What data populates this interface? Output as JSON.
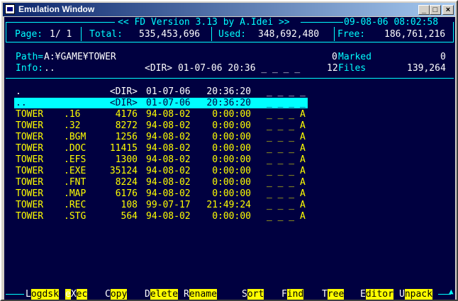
{
  "window": {
    "title": "Emulation Window",
    "min": "_",
    "max": "□",
    "close": "×"
  },
  "header": {
    "version": "<< FD Version 3.13 by A.Idei >>",
    "datetime": "09-08-06 08:02:58",
    "page_label": "Page:",
    "page_value": "1/ 1",
    "total_label": "Total:",
    "total_value": "535,453,696",
    "used_label": "Used:",
    "used_value": "348,692,480",
    "free_label": "Free:",
    "free_value": "186,761,216"
  },
  "info": {
    "path_label": "Path=",
    "path_value": "A:¥GAME¥TOWER",
    "marked_count": "0",
    "marked_label": "Marked",
    "marked_value": "0",
    "info_label": "Info:",
    "info_value": "..",
    "info_detail": "<DIR> 01-07-06 20:36 _ _ _ _",
    "files_count": "12",
    "files_label": "Files",
    "files_value": "139,264"
  },
  "files": [
    {
      "name": ".",
      "ext": "",
      "size": "<DIR>",
      "date": "01-07-06",
      "time": "20:36:20",
      "attr": "_ _ _ _",
      "type": "dir"
    },
    {
      "name": "..",
      "ext": "",
      "size": "<DIR>",
      "date": "01-07-06",
      "time": "20:36:20",
      "attr": "_ _ _ _",
      "type": "sel"
    },
    {
      "name": "TOWER",
      "ext": ".16",
      "size": "4176",
      "date": "94-08-02",
      "time": "0:00:00",
      "attr": "_ _ _ A",
      "type": "file"
    },
    {
      "name": "TOWER",
      "ext": ".32",
      "size": "8272",
      "date": "94-08-02",
      "time": "0:00:00",
      "attr": "_ _ _ A",
      "type": "file"
    },
    {
      "name": "TOWER",
      "ext": ".BGM",
      "size": "1256",
      "date": "94-08-02",
      "time": "0:00:00",
      "attr": "_ _ _ A",
      "type": "file"
    },
    {
      "name": "TOWER",
      "ext": ".DOC",
      "size": "11415",
      "date": "94-08-02",
      "time": "0:00:00",
      "attr": "_ _ _ A",
      "type": "file"
    },
    {
      "name": "TOWER",
      "ext": ".EFS",
      "size": "1300",
      "date": "94-08-02",
      "time": "0:00:00",
      "attr": "_ _ _ A",
      "type": "file"
    },
    {
      "name": "TOWER",
      "ext": ".EXE",
      "size": "35124",
      "date": "94-08-02",
      "time": "0:00:00",
      "attr": "_ _ _ A",
      "type": "file"
    },
    {
      "name": "TOWER",
      "ext": ".FNT",
      "size": "8224",
      "date": "94-08-02",
      "time": "0:00:00",
      "attr": "_ _ _ A",
      "type": "file"
    },
    {
      "name": "TOWER",
      "ext": ".MAP",
      "size": "6176",
      "date": "94-08-02",
      "time": "0:00:00",
      "attr": "_ _ _ A",
      "type": "file"
    },
    {
      "name": "TOWER",
      "ext": ".REC",
      "size": "108",
      "date": "99-07-17",
      "time": "21:49:24",
      "attr": "_ _ _ A",
      "type": "file"
    },
    {
      "name": "TOWER",
      "ext": ".STG",
      "size": "564",
      "date": "94-08-02",
      "time": "0:00:00",
      "attr": "_ _ _ A",
      "type": "file"
    }
  ],
  "fkeys": [
    {
      "name": "logdsk",
      "pre": "",
      "hot": "L",
      "post": "ogdsk"
    },
    {
      "name": "exec",
      "pre": "e",
      "hot": "X",
      "post": "ec"
    },
    {
      "name": "copy",
      "pre": "",
      "hot": "C",
      "post": "opy"
    },
    {
      "name": "delete",
      "pre": "",
      "hot": "D",
      "post": "elete"
    },
    {
      "name": "rename",
      "pre": "",
      "hot": "R",
      "post": "ename"
    },
    {
      "name": "sort",
      "pre": "",
      "hot": "S",
      "post": "ort"
    },
    {
      "name": "find",
      "pre": "",
      "hot": "F",
      "post": "ind"
    },
    {
      "name": "tree",
      "pre": "",
      "hot": "T",
      "post": "ree"
    },
    {
      "name": "editor",
      "pre": "",
      "hot": "E",
      "post": "ditor"
    },
    {
      "name": "unpack",
      "pre": "",
      "hot": "U",
      "post": "npack"
    }
  ]
}
